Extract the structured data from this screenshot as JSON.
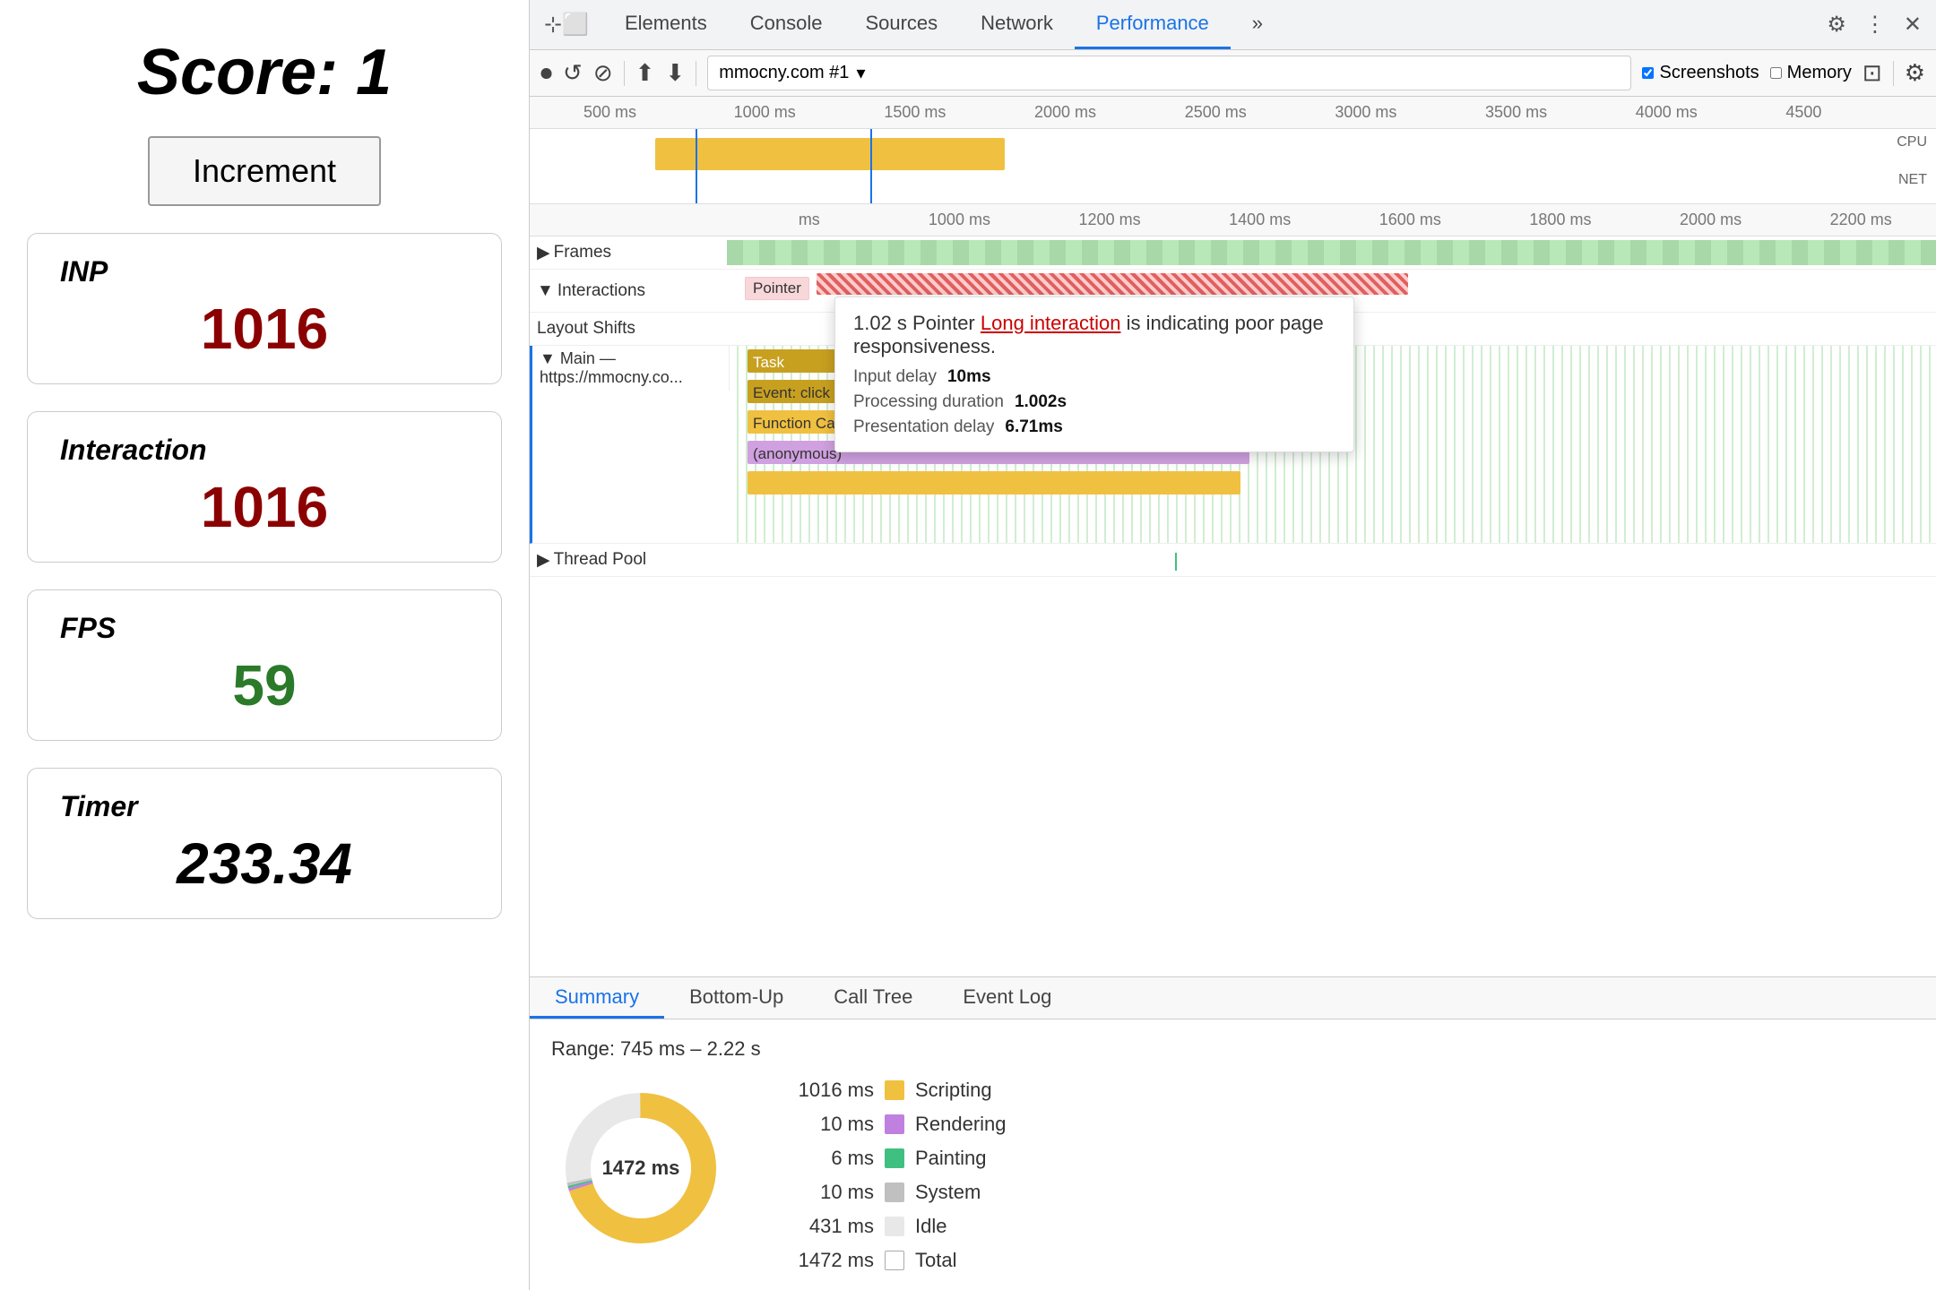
{
  "left": {
    "score_label": "Score:  1",
    "increment_button": "Increment",
    "metrics": [
      {
        "id": "inp",
        "label": "INP",
        "value": "1016",
        "color": "red"
      },
      {
        "id": "interaction",
        "label": "Interaction",
        "value": "1016",
        "color": "red"
      },
      {
        "id": "fps",
        "label": "FPS",
        "value": "59",
        "color": "green"
      },
      {
        "id": "timer",
        "label": "Timer",
        "value": "233.34",
        "color": "black"
      }
    ]
  },
  "devtools": {
    "tabs": [
      "Elements",
      "Console",
      "Sources",
      "Network",
      "Performance",
      "»"
    ],
    "active_tab": "Performance",
    "toolbar": {
      "url": "mmocny.com #1",
      "screenshots_label": "Screenshots",
      "memory_label": "Memory"
    },
    "timeline": {
      "ruler_marks": [
        "500 ms",
        "1000 ms",
        "1500 ms",
        "2000 ms",
        "2500 ms",
        "3000 ms",
        "3500 ms",
        "4000 ms",
        "4500"
      ]
    },
    "perf": {
      "time_marks": [
        "ms",
        "1000 ms",
        "1200 ms",
        "1400 ms",
        "1600 ms",
        "1800 ms",
        "2000 ms",
        "2200 ms"
      ],
      "rows": {
        "frames_label": "Frames",
        "interactions_label": "Interactions",
        "layout_shifts_label": "Layout Shifts",
        "main_label": "Main — https://mmocny.co...",
        "task_label": "Task",
        "event_click_label": "Event: click",
        "function_call_label": "Function Call",
        "anonymous_label": "(anonymous)",
        "thread_pool_label": "Thread Pool"
      },
      "tooltip": {
        "header": "1.02 s  Pointer",
        "link_text": "Long interaction",
        "link_suffix": " is indicating poor page responsiveness.",
        "input_delay_label": "Input delay",
        "input_delay_value": "10ms",
        "processing_label": "Processing duration",
        "processing_value": "1.002s",
        "presentation_label": "Presentation delay",
        "presentation_value": "6.71ms"
      }
    },
    "bottom_tabs": [
      "Summary",
      "Bottom-Up",
      "Call Tree",
      "Event Log"
    ],
    "active_bottom_tab": "Summary",
    "summary": {
      "range_text": "Range: 745 ms – 2.22 s",
      "donut_center": "1472 ms",
      "legend": [
        {
          "ms": "1016 ms",
          "color": "#f0c040",
          "name": "Scripting"
        },
        {
          "ms": "10 ms",
          "color": "#c080e0",
          "name": "Rendering"
        },
        {
          "ms": "6 ms",
          "color": "#40c080",
          "name": "Painting"
        },
        {
          "ms": "10 ms",
          "color": "#c0c0c0",
          "name": "System"
        },
        {
          "ms": "431 ms",
          "color": "#e8e8e8",
          "name": "Idle"
        },
        {
          "ms": "1472 ms",
          "color": "#ffffff",
          "name": "Total",
          "border": true
        }
      ]
    }
  }
}
